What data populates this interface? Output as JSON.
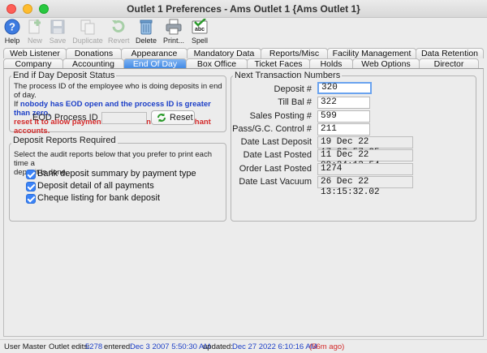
{
  "window": {
    "title": "Outlet 1 Preferences - Ams Outlet 1 {Ams Outlet 1}"
  },
  "toolbar": [
    {
      "id": "help",
      "label": "Help",
      "enabled": true,
      "icon": "help-icon"
    },
    {
      "id": "new",
      "label": "New",
      "enabled": false,
      "icon": "new-icon"
    },
    {
      "id": "save",
      "label": "Save",
      "enabled": false,
      "icon": "save-icon"
    },
    {
      "id": "duplicate",
      "label": "Duplicate",
      "enabled": false,
      "icon": "duplicate-icon"
    },
    {
      "id": "revert",
      "label": "Revert",
      "enabled": false,
      "icon": "revert-icon"
    },
    {
      "id": "delete",
      "label": "Delete",
      "enabled": true,
      "icon": "trash-icon"
    },
    {
      "id": "print",
      "label": "Print...",
      "enabled": true,
      "icon": "printer-icon"
    },
    {
      "id": "spell",
      "label": "Spell",
      "enabled": true,
      "icon": "spell-check-icon"
    }
  ],
  "tabs_row1": [
    "Web Listener",
    "Donations",
    "Appearance",
    "Mandatory Data",
    "Reports/Misc",
    "Facility Management",
    "Data Retention"
  ],
  "tabs_row2": [
    "Company",
    "Accounting",
    "End Of Day",
    "Box Office",
    "Ticket Faces",
    "Holds",
    "Web Options",
    "Director"
  ],
  "selected_tab": "End Of Day",
  "eod_status": {
    "title": "End if Day Deposit Status",
    "line1": "The process ID of the employee who is doing deposits in end of day.",
    "line2_prefix": "If ",
    "line2_blue": "nobody has EOD open and the process ID is greater than zero,",
    "line3_red": "reset it to allow payments to be taken for all merchant accounts.",
    "process_id_label": "EOD Process ID",
    "process_id_value": "",
    "reset_label": "Reset"
  },
  "deposit_reports": {
    "title": "Deposit Reports Required",
    "description_line1": "Select the audit reports below that you prefer to print each time a",
    "description_line2": "deposit is done.",
    "options": [
      {
        "label": "Bank deposit summary by payment type",
        "checked": true
      },
      {
        "label": "Deposit detail of all payments",
        "checked": true
      },
      {
        "label": "Cheque listing for bank deposit",
        "checked": true
      }
    ]
  },
  "next_numbers": {
    "title": "Next Transaction Numbers",
    "fields": [
      {
        "label": "Deposit #",
        "value": "320"
      },
      {
        "label": "Till Bal #",
        "value": "322"
      },
      {
        "label": "Sales Posting #",
        "value": "599"
      },
      {
        "label": "Pass/G.C. Control #",
        "value": "211"
      },
      {
        "label": "Date Last Deposit",
        "value": "19 Dec 22  17:32:57.35"
      },
      {
        "label": "Date Last Posted",
        "value": "11 Dec 22  09:24:13.54"
      },
      {
        "label": "Order Last Posted",
        "value": "1274"
      },
      {
        "label": "Date Last Vacuum",
        "value": "26 Dec 22  13:15:32.02"
      }
    ]
  },
  "status_bar": {
    "user": "User Master",
    "edits_label": "Outlet edits:",
    "edits_value": "5278",
    "entered_label": "entered:",
    "entered_value": "Dec 3 2007 5:50:30 AM",
    "updated_label": "updated:",
    "updated_value": "Dec 27 2022 6:10:16 AM",
    "ago": "(56m ago)"
  },
  "colors": {
    "accent": "#3c86e4",
    "link_blue": "#1c3fc7",
    "warning_red": "#d42a2a"
  }
}
